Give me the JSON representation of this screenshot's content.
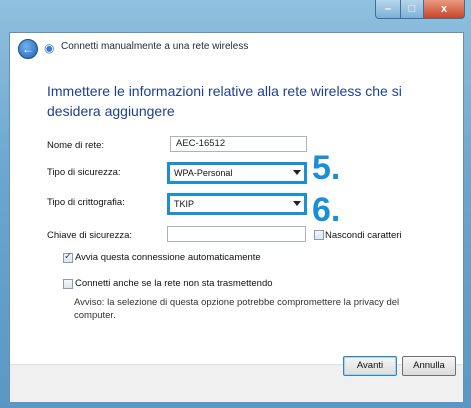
{
  "window": {
    "title": "Connetti manualmente a una rete wireless",
    "controls": {
      "minimize": "–",
      "maximize": "□",
      "close": "x"
    }
  },
  "page": {
    "heading": "Immettere le informazioni relative alla rete wireless che si desidera aggiungere"
  },
  "form": {
    "network_name": {
      "label": "Nome di rete:",
      "value": "AEC-16512"
    },
    "security_type": {
      "label": "Tipo di sicurezza:",
      "value": "WPA-Personal"
    },
    "encryption_type": {
      "label": "Tipo di crittografia:",
      "value": "TKIP"
    },
    "security_key": {
      "label": "Chiave di sicurezza:",
      "value": ""
    },
    "hide_characters": {
      "label": "Nascondi caratteri",
      "checked": false
    }
  },
  "options": {
    "auto_start": {
      "label": "Avvia questa connessione automaticamente",
      "checked": true
    },
    "connect_hidden": {
      "label": "Connetti anche se la rete non sta trasmettendo",
      "checked": false
    },
    "warning": "Avviso: la selezione di questa opzione potrebbe compromettere la privacy del computer."
  },
  "annotations": {
    "step5": "5.",
    "step6": "6."
  },
  "buttons": {
    "next": "Avanti",
    "cancel": "Annulla"
  },
  "colors": {
    "callout": "#1a8fd6",
    "heading": "#1e3f91"
  }
}
